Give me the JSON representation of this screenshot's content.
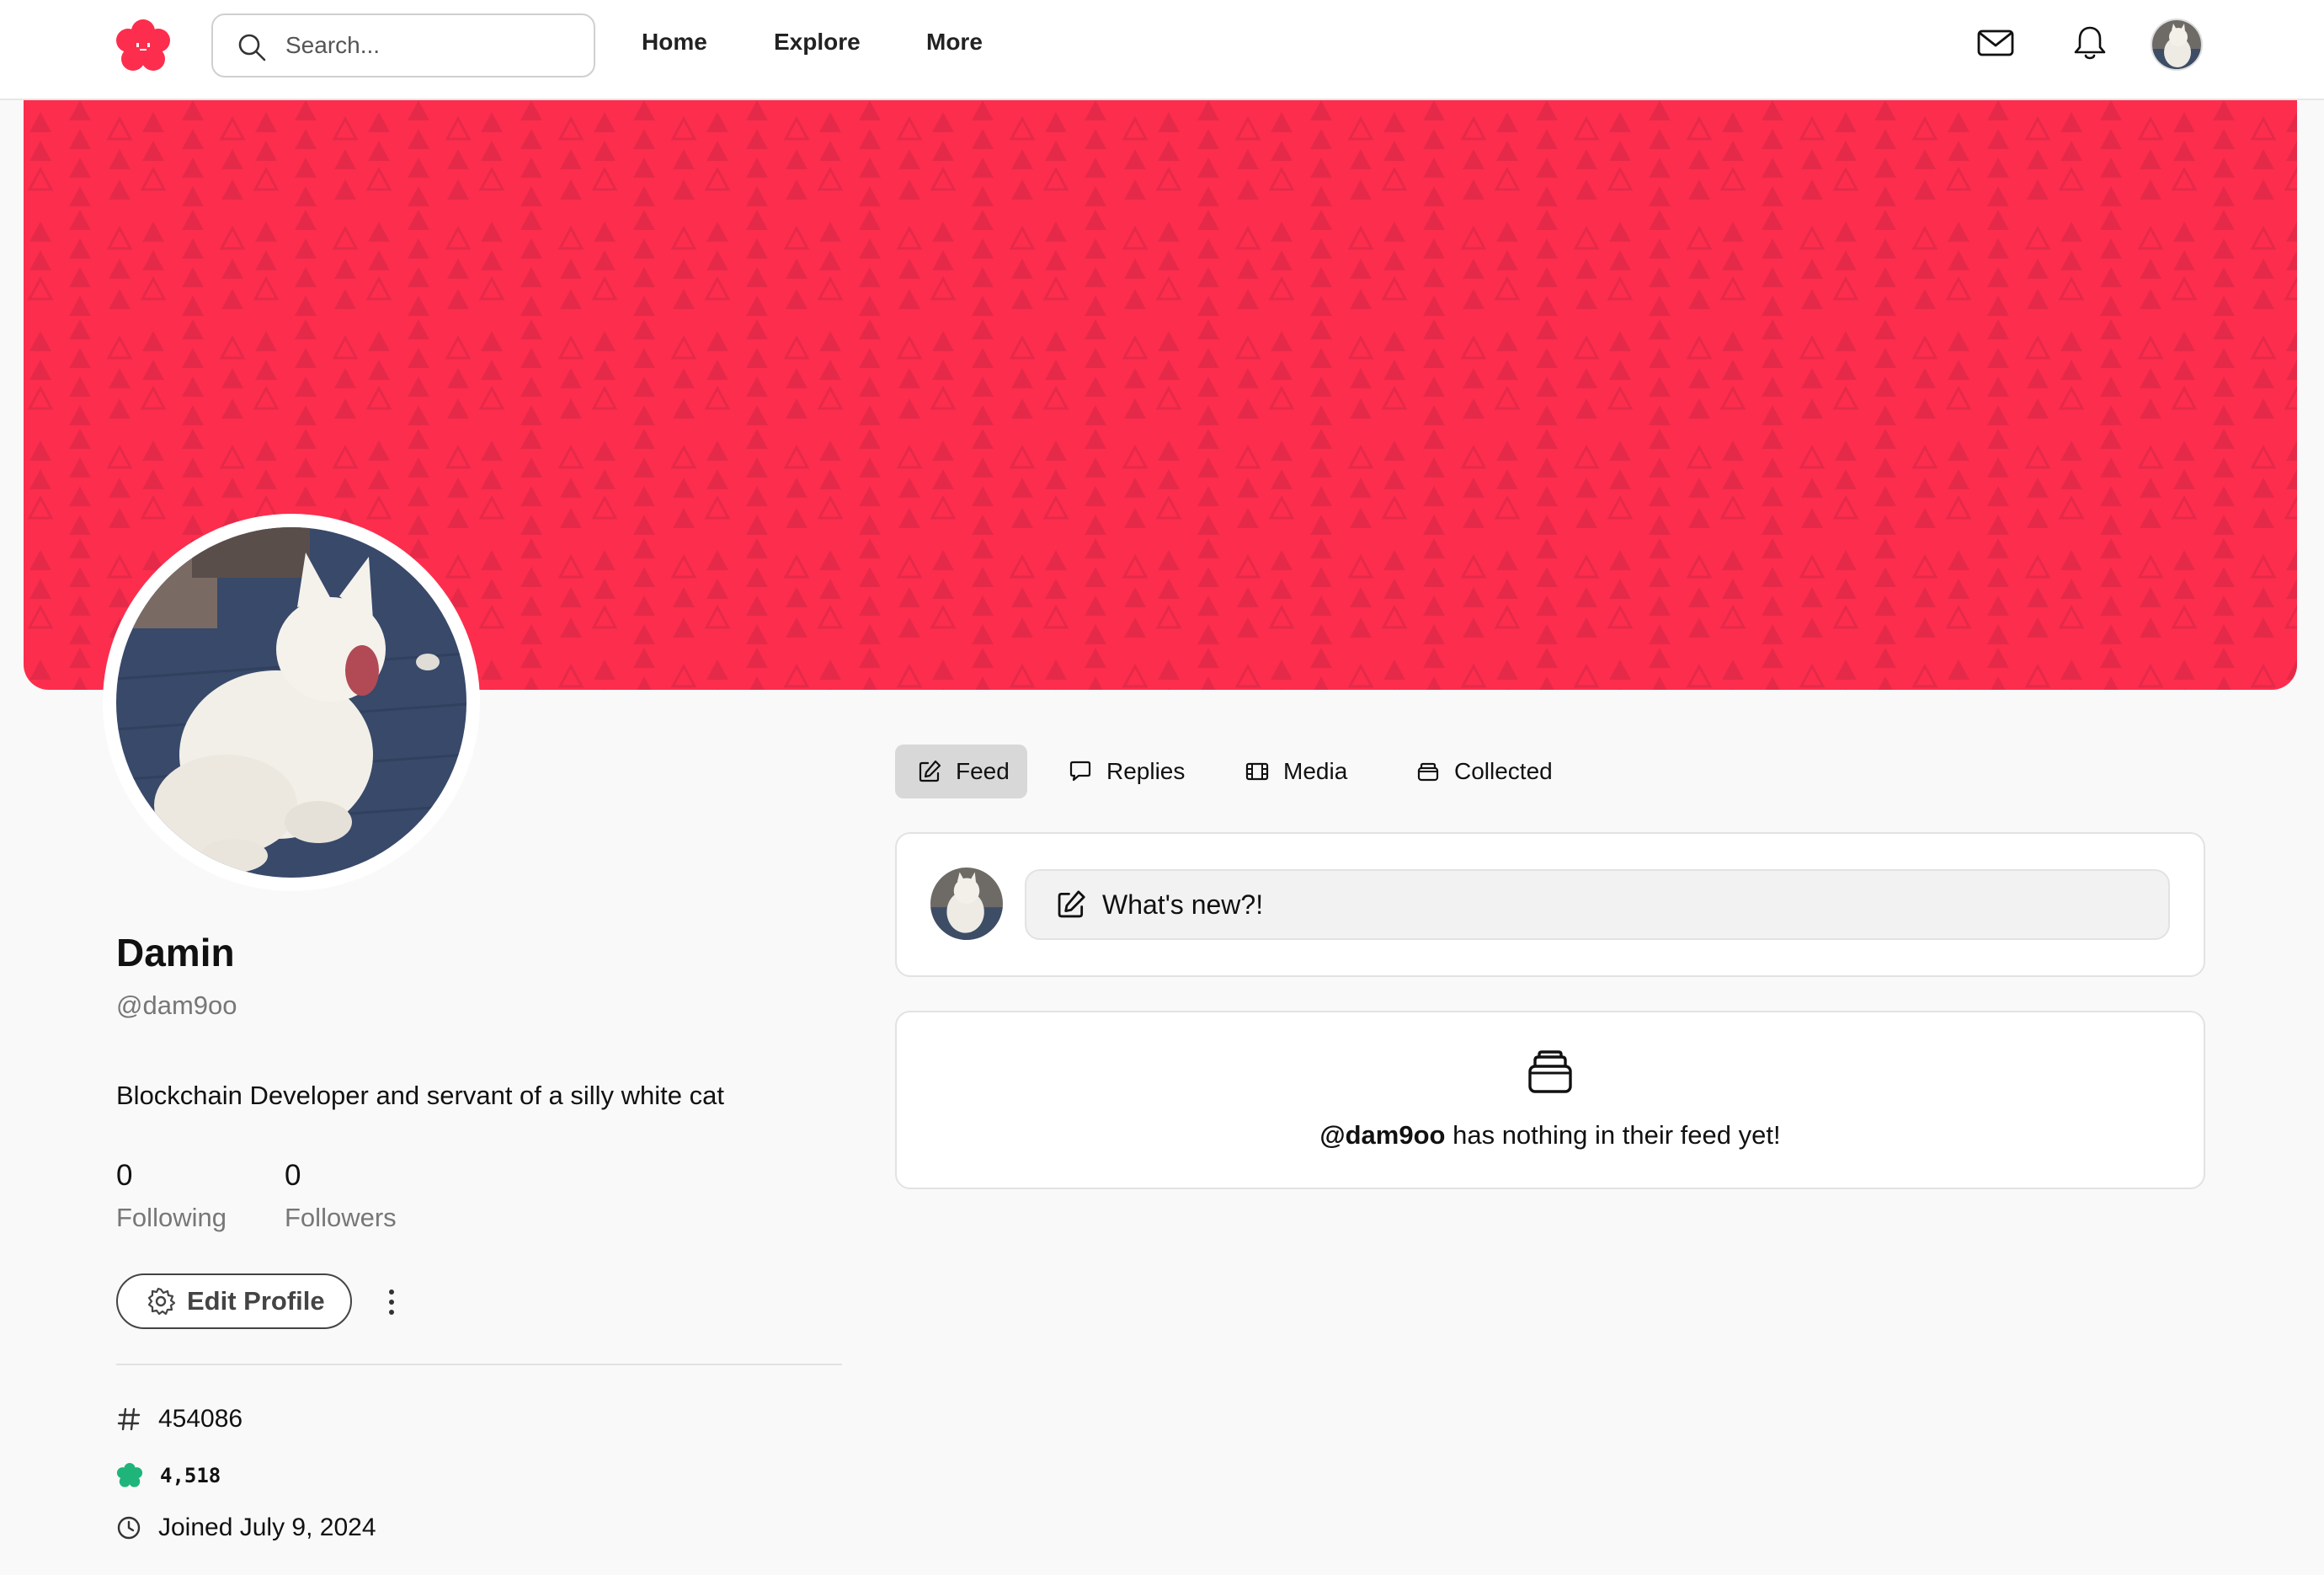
{
  "header": {
    "search_placeholder": "Search...",
    "nav": {
      "home": "Home",
      "explore": "Explore",
      "more": "More"
    },
    "icons": [
      "flower-logo-icon",
      "search-icon",
      "mail-icon",
      "bell-icon"
    ]
  },
  "colors": {
    "brand": "#fd2d4d",
    "banner_pattern": "#e52a49",
    "badge_green": "#1fb57a",
    "active_tab_bg": "#d8d8d8"
  },
  "profile": {
    "name": "Damin",
    "handle": "@dam9oo",
    "bio": "Blockchain Developer and servant of a silly white cat",
    "following_count": "0",
    "following_label": "Following",
    "followers_count": "0",
    "followers_label": "Followers",
    "edit_label": "Edit Profile",
    "id_number": "454086",
    "points": "4,518",
    "joined": "Joined July 9, 2024"
  },
  "tabs": [
    {
      "label": "Feed",
      "icon": "pencil-square-icon",
      "active": true
    },
    {
      "label": "Replies",
      "icon": "speech-bubble-icon",
      "active": false
    },
    {
      "label": "Media",
      "icon": "film-icon",
      "active": false
    },
    {
      "label": "Collected",
      "icon": "stack-icon",
      "active": false
    }
  ],
  "composer": {
    "placeholder": "What's new?!"
  },
  "empty_feed": {
    "handle": "@dam9oo",
    "message": " has nothing in their feed yet!"
  }
}
